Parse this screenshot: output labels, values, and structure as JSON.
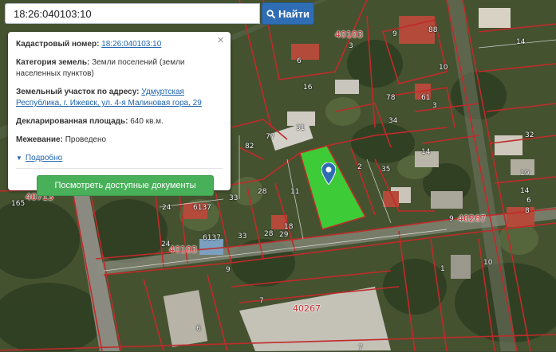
{
  "search": {
    "value": "18:26:040103:10",
    "button_label": "Найти",
    "button_icon": "search-icon"
  },
  "popup": {
    "close_symbol": "×",
    "cadastral_label": "Кадастровый номер:",
    "cadastral_value": "18:26:040103:10",
    "category_label": "Категория земель:",
    "category_value": "Земли поселений (земли населенных пунктов)",
    "address_label": "Земельный участок по адресу:",
    "address_value": "Удмуртская Республика, г. Ижевск, ул. 4-я Малиновая гора, 29",
    "area_label": "Декларированная площадь:",
    "area_value": "640 кв.м.",
    "survey_label": "Межевание:",
    "survey_value": "Проведено",
    "more_label": "Подробно",
    "docs_button": "Посмотреть доступные документы"
  },
  "map": {
    "accent_color": "#2f6db5",
    "parcel_highlight_color": "#3bff3b",
    "boundary_color": "#c12a2a",
    "quarter_numbers": [
      "40103",
      "40713",
      "40267",
      "40103",
      "40267"
    ],
    "plot_numbers": [
      "9",
      "88",
      "14",
      "3",
      "6",
      "16",
      "61",
      "78",
      "10",
      "34",
      "3",
      "31",
      "77",
      "82",
      "32",
      "14",
      "2",
      "35",
      "11",
      "28",
      "33",
      "165",
      "24",
      "6137",
      "29",
      "9",
      "18",
      "24",
      "6137",
      "33",
      "28",
      "9",
      "1",
      "10",
      "7",
      "6",
      "7",
      "19",
      "14",
      "6",
      "8"
    ]
  }
}
